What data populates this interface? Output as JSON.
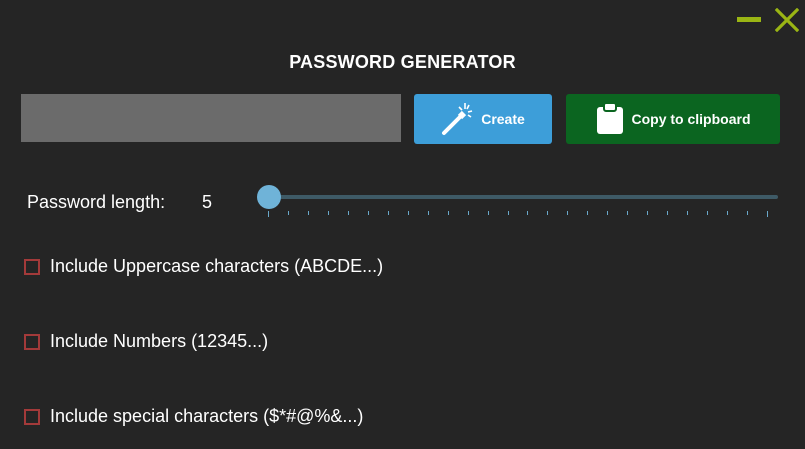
{
  "window": {
    "controls": {
      "minimize_icon": "minimize-icon",
      "close_icon": "close-icon",
      "accent_color": "#9ab514"
    }
  },
  "header": {
    "title": "PASSWORD GENERATOR"
  },
  "generator": {
    "output_value": "",
    "create_label": "Create",
    "create_icon": "magic-wand-icon",
    "create_color": "#3d9ed9",
    "copy_label": "Copy to clipboard",
    "copy_icon": "clipboard-icon",
    "copy_color": "#0b6520"
  },
  "length": {
    "label": "Password length:",
    "value": "5",
    "slider": {
      "min": 5,
      "max": 30,
      "value": 5,
      "tick_count": 26
    }
  },
  "options": [
    {
      "label": "Include Uppercase characters (ABCDE...)",
      "checked": false
    },
    {
      "label": "Include Numbers (12345...)",
      "checked": false
    },
    {
      "label": "Include special characters ($*#@%&...)",
      "checked": false
    }
  ],
  "colors": {
    "background": "#252525",
    "checkbox_border": "#a33a3a",
    "slider_accent": "#6fb3d8"
  }
}
